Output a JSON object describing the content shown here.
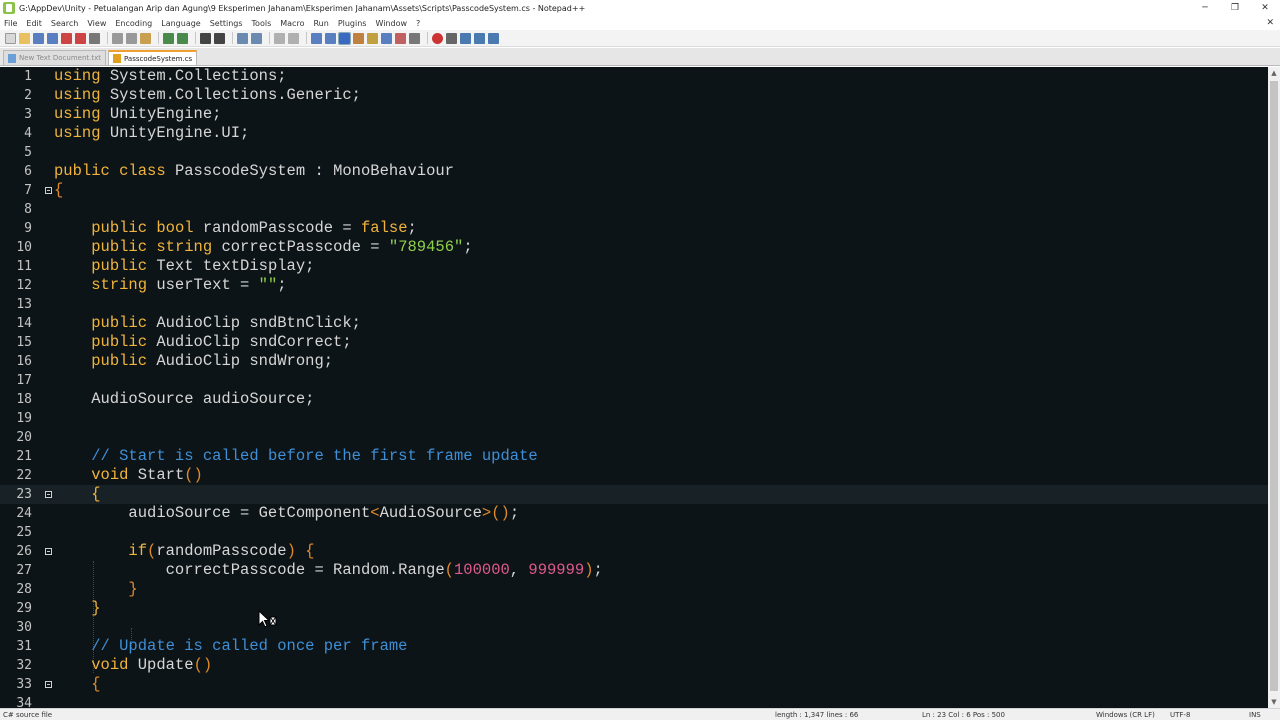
{
  "window": {
    "title": "G:\\AppDev\\Unity - Petualangan Arip dan Agung\\9 Eksperimen Jahanam\\Eksperimen Jahanam\\Assets\\Scripts\\PasscodeSystem.cs - Notepad++",
    "minimize_glyph": "─",
    "maximize_glyph": "❐",
    "close_glyph": "✕"
  },
  "menu": [
    "File",
    "Edit",
    "Search",
    "View",
    "Encoding",
    "Language",
    "Settings",
    "Tools",
    "Macro",
    "Run",
    "Plugins",
    "Window",
    "?"
  ],
  "menu_close_glyph": "✕",
  "tabs": [
    {
      "label": "New Text Document.txt",
      "active": false
    },
    {
      "label": "PasscodeSystem.cs",
      "active": true
    }
  ],
  "editor": {
    "lines": [
      {
        "n": "1",
        "html": "<span class=\"kw\">using</span> System.Collections;"
      },
      {
        "n": "2",
        "html": "<span class=\"kw\">using</span> System.Collections.Generic;"
      },
      {
        "n": "3",
        "html": "<span class=\"kw\">using</span> UnityEngine;"
      },
      {
        "n": "4",
        "html": "<span class=\"kw\">using</span> UnityEngine.UI;"
      },
      {
        "n": "5",
        "html": ""
      },
      {
        "n": "6",
        "html": "<span class=\"kw\">public</span> <span class=\"kw\">class</span> PasscodeSystem : MonoBehaviour"
      },
      {
        "n": "7",
        "html": "<span class=\"br\">{</span>",
        "fold": true
      },
      {
        "n": "8",
        "html": ""
      },
      {
        "n": "9",
        "html": "    <span class=\"kw\">public</span> <span class=\"kw\">bool</span> randomPasscode = <span class=\"kw\">false</span>;"
      },
      {
        "n": "10",
        "html": "    <span class=\"kw\">public</span> <span class=\"kw\">string</span> correctPasscode = <span class=\"str\">\"789456\"</span>;"
      },
      {
        "n": "11",
        "html": "    <span class=\"kw\">public</span> Text textDisplay;"
      },
      {
        "n": "12",
        "html": "    <span class=\"kw\">string</span> userText = <span class=\"str\">\"\"</span>;"
      },
      {
        "n": "13",
        "html": ""
      },
      {
        "n": "14",
        "html": "    <span class=\"kw\">public</span> AudioClip sndBtnClick;"
      },
      {
        "n": "15",
        "html": "    <span class=\"kw\">public</span> AudioClip sndCorrect;"
      },
      {
        "n": "16",
        "html": "    <span class=\"kw\">public</span> AudioClip sndWrong;"
      },
      {
        "n": "17",
        "html": ""
      },
      {
        "n": "18",
        "html": "    AudioSource audioSource;"
      },
      {
        "n": "19",
        "html": ""
      },
      {
        "n": "20",
        "html": ""
      },
      {
        "n": "21",
        "html": "    <span class=\"cm\">// Start is called before the first frame update</span>"
      },
      {
        "n": "22",
        "html": "    <span class=\"kw\">void</span> Start<span class=\"br\">()</span>"
      },
      {
        "n": "23",
        "html": "    <span class=\"kw\">{</span>",
        "fold": true,
        "current": true
      },
      {
        "n": "24",
        "html": "        audioSource = GetComponent<span class=\"br\">&lt;</span>AudioSource<span class=\"br\">&gt;()</span>;"
      },
      {
        "n": "25",
        "html": ""
      },
      {
        "n": "26",
        "html": "        <span class=\"kw\">if</span><span class=\"br\">(</span>randomPasscode<span class=\"br\">)</span> <span class=\"br\">{</span>",
        "fold": true
      },
      {
        "n": "27",
        "html": "            correctPasscode = Random.Range<span class=\"br\">(</span><span class=\"num\">100000</span>, <span class=\"num\">999999</span><span class=\"br\">)</span>;"
      },
      {
        "n": "28",
        "html": "        <span class=\"br\">}</span>"
      },
      {
        "n": "29",
        "html": "    <span class=\"kw\">}</span>"
      },
      {
        "n": "30",
        "html": ""
      },
      {
        "n": "31",
        "html": "    <span class=\"cm\">// Update is called once per frame</span>"
      },
      {
        "n": "32",
        "html": "    <span class=\"kw\">void</span> Update<span class=\"br\">()</span>"
      },
      {
        "n": "33",
        "html": "    <span class=\"br\">{</span>",
        "fold": true
      },
      {
        "n": "34",
        "html": ""
      }
    ]
  },
  "statusbar": {
    "file_type": "C# source file",
    "length_lines": "length : 1,347    lines : 66",
    "position": "Ln : 23    Col : 6    Pos : 500",
    "eol": "Windows (CR LF)",
    "encoding": "UTF-8",
    "mode": "INS"
  },
  "colors": {
    "editor_bg": "#0d1418",
    "keyword": "#f0b43c",
    "string": "#8ed14a",
    "number": "#e05a8c",
    "comment": "#3f8fd6"
  }
}
